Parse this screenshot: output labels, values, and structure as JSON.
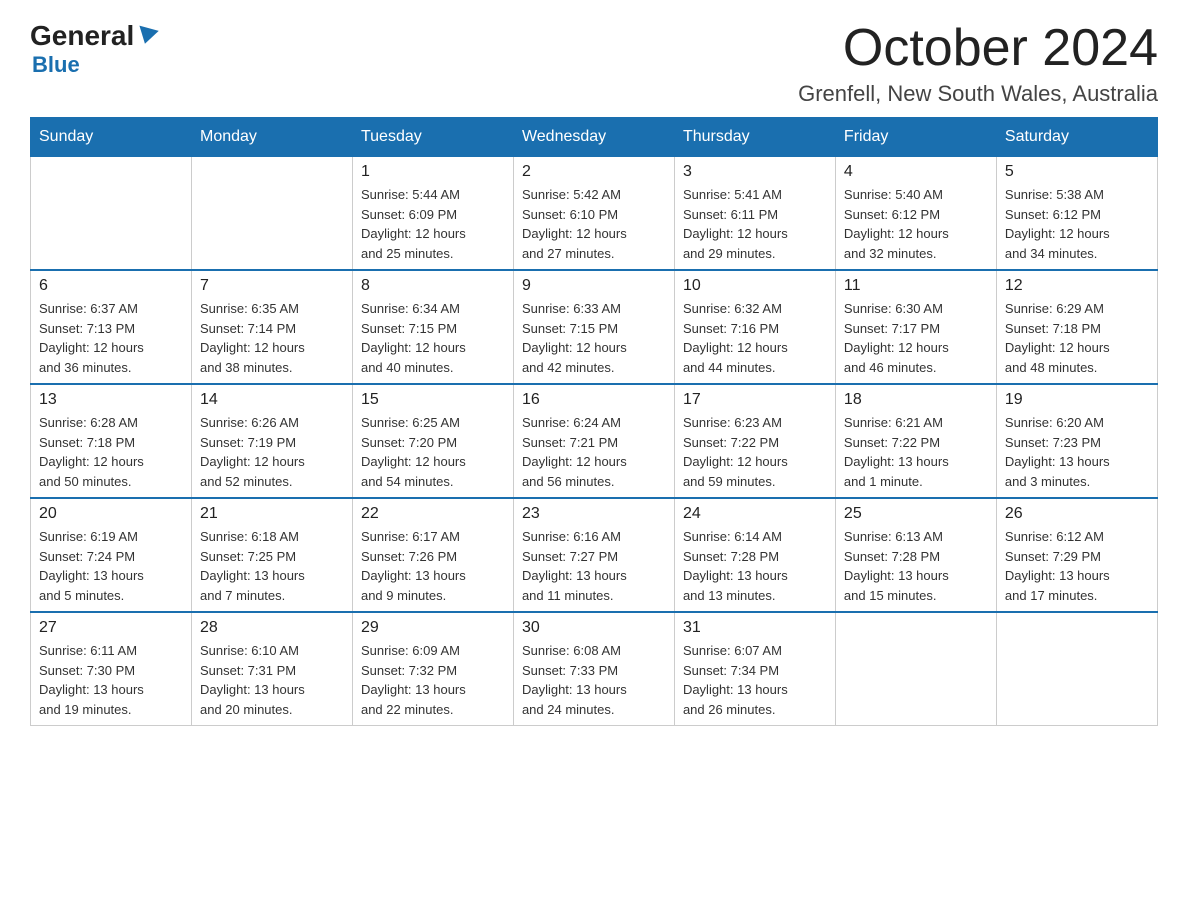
{
  "header": {
    "logo_general": "General",
    "logo_blue": "Blue",
    "month_title": "October 2024",
    "location": "Grenfell, New South Wales, Australia"
  },
  "days_of_week": [
    "Sunday",
    "Monday",
    "Tuesday",
    "Wednesday",
    "Thursday",
    "Friday",
    "Saturday"
  ],
  "weeks": [
    [
      {
        "day": "",
        "info": ""
      },
      {
        "day": "",
        "info": ""
      },
      {
        "day": "1",
        "info": "Sunrise: 5:44 AM\nSunset: 6:09 PM\nDaylight: 12 hours\nand 25 minutes."
      },
      {
        "day": "2",
        "info": "Sunrise: 5:42 AM\nSunset: 6:10 PM\nDaylight: 12 hours\nand 27 minutes."
      },
      {
        "day": "3",
        "info": "Sunrise: 5:41 AM\nSunset: 6:11 PM\nDaylight: 12 hours\nand 29 minutes."
      },
      {
        "day": "4",
        "info": "Sunrise: 5:40 AM\nSunset: 6:12 PM\nDaylight: 12 hours\nand 32 minutes."
      },
      {
        "day": "5",
        "info": "Sunrise: 5:38 AM\nSunset: 6:12 PM\nDaylight: 12 hours\nand 34 minutes."
      }
    ],
    [
      {
        "day": "6",
        "info": "Sunrise: 6:37 AM\nSunset: 7:13 PM\nDaylight: 12 hours\nand 36 minutes."
      },
      {
        "day": "7",
        "info": "Sunrise: 6:35 AM\nSunset: 7:14 PM\nDaylight: 12 hours\nand 38 minutes."
      },
      {
        "day": "8",
        "info": "Sunrise: 6:34 AM\nSunset: 7:15 PM\nDaylight: 12 hours\nand 40 minutes."
      },
      {
        "day": "9",
        "info": "Sunrise: 6:33 AM\nSunset: 7:15 PM\nDaylight: 12 hours\nand 42 minutes."
      },
      {
        "day": "10",
        "info": "Sunrise: 6:32 AM\nSunset: 7:16 PM\nDaylight: 12 hours\nand 44 minutes."
      },
      {
        "day": "11",
        "info": "Sunrise: 6:30 AM\nSunset: 7:17 PM\nDaylight: 12 hours\nand 46 minutes."
      },
      {
        "day": "12",
        "info": "Sunrise: 6:29 AM\nSunset: 7:18 PM\nDaylight: 12 hours\nand 48 minutes."
      }
    ],
    [
      {
        "day": "13",
        "info": "Sunrise: 6:28 AM\nSunset: 7:18 PM\nDaylight: 12 hours\nand 50 minutes."
      },
      {
        "day": "14",
        "info": "Sunrise: 6:26 AM\nSunset: 7:19 PM\nDaylight: 12 hours\nand 52 minutes."
      },
      {
        "day": "15",
        "info": "Sunrise: 6:25 AM\nSunset: 7:20 PM\nDaylight: 12 hours\nand 54 minutes."
      },
      {
        "day": "16",
        "info": "Sunrise: 6:24 AM\nSunset: 7:21 PM\nDaylight: 12 hours\nand 56 minutes."
      },
      {
        "day": "17",
        "info": "Sunrise: 6:23 AM\nSunset: 7:22 PM\nDaylight: 12 hours\nand 59 minutes."
      },
      {
        "day": "18",
        "info": "Sunrise: 6:21 AM\nSunset: 7:22 PM\nDaylight: 13 hours\nand 1 minute."
      },
      {
        "day": "19",
        "info": "Sunrise: 6:20 AM\nSunset: 7:23 PM\nDaylight: 13 hours\nand 3 minutes."
      }
    ],
    [
      {
        "day": "20",
        "info": "Sunrise: 6:19 AM\nSunset: 7:24 PM\nDaylight: 13 hours\nand 5 minutes."
      },
      {
        "day": "21",
        "info": "Sunrise: 6:18 AM\nSunset: 7:25 PM\nDaylight: 13 hours\nand 7 minutes."
      },
      {
        "day": "22",
        "info": "Sunrise: 6:17 AM\nSunset: 7:26 PM\nDaylight: 13 hours\nand 9 minutes."
      },
      {
        "day": "23",
        "info": "Sunrise: 6:16 AM\nSunset: 7:27 PM\nDaylight: 13 hours\nand 11 minutes."
      },
      {
        "day": "24",
        "info": "Sunrise: 6:14 AM\nSunset: 7:28 PM\nDaylight: 13 hours\nand 13 minutes."
      },
      {
        "day": "25",
        "info": "Sunrise: 6:13 AM\nSunset: 7:28 PM\nDaylight: 13 hours\nand 15 minutes."
      },
      {
        "day": "26",
        "info": "Sunrise: 6:12 AM\nSunset: 7:29 PM\nDaylight: 13 hours\nand 17 minutes."
      }
    ],
    [
      {
        "day": "27",
        "info": "Sunrise: 6:11 AM\nSunset: 7:30 PM\nDaylight: 13 hours\nand 19 minutes."
      },
      {
        "day": "28",
        "info": "Sunrise: 6:10 AM\nSunset: 7:31 PM\nDaylight: 13 hours\nand 20 minutes."
      },
      {
        "day": "29",
        "info": "Sunrise: 6:09 AM\nSunset: 7:32 PM\nDaylight: 13 hours\nand 22 minutes."
      },
      {
        "day": "30",
        "info": "Sunrise: 6:08 AM\nSunset: 7:33 PM\nDaylight: 13 hours\nand 24 minutes."
      },
      {
        "day": "31",
        "info": "Sunrise: 6:07 AM\nSunset: 7:34 PM\nDaylight: 13 hours\nand 26 minutes."
      },
      {
        "day": "",
        "info": ""
      },
      {
        "day": "",
        "info": ""
      }
    ]
  ]
}
